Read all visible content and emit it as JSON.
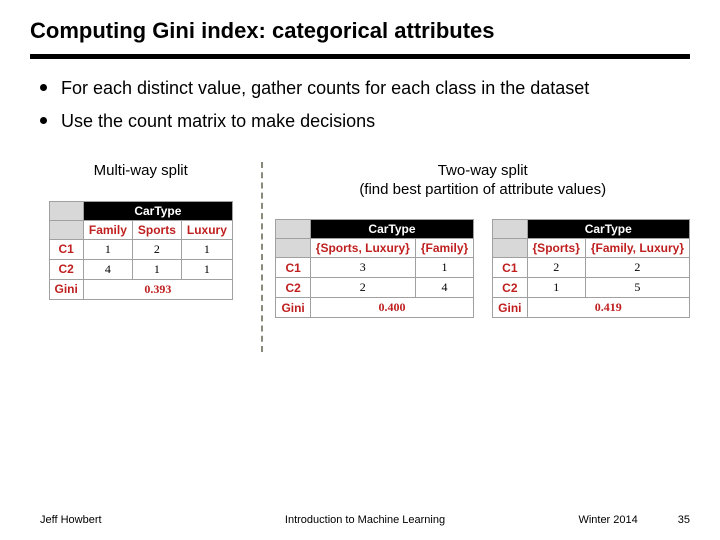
{
  "title": "Computing Gini index: categorical attributes",
  "bullets": [
    "For each distinct value, gather counts for each class in the dataset",
    "Use the count matrix to make decisions"
  ],
  "left_subtitle": "Multi-way split",
  "right_subtitle_line1": "Two-way split",
  "right_subtitle_line2": "(find best partition of attribute values)",
  "cartype_label": "CarType",
  "gini_label": "Gini",
  "classes": {
    "c1": "C1",
    "c2": "C2"
  },
  "multi": {
    "cols": [
      "Family",
      "Sports",
      "Luxury"
    ],
    "c1": [
      "1",
      "2",
      "1"
    ],
    "c2": [
      "4",
      "1",
      "1"
    ],
    "gini": "0.393"
  },
  "twoA": {
    "cols": [
      "{Sports, Luxury}",
      "{Family}"
    ],
    "c1": [
      "3",
      "1"
    ],
    "c2": [
      "2",
      "4"
    ],
    "gini": "0.400"
  },
  "twoB": {
    "cols": [
      "{Sports}",
      "{Family, Luxury}"
    ],
    "c1": [
      "2",
      "2"
    ],
    "c2": [
      "1",
      "5"
    ],
    "gini": "0.419"
  },
  "footer": {
    "left": "Jeff Howbert",
    "center": "Introduction to Machine Learning",
    "term": "Winter 2014",
    "page": "35"
  }
}
